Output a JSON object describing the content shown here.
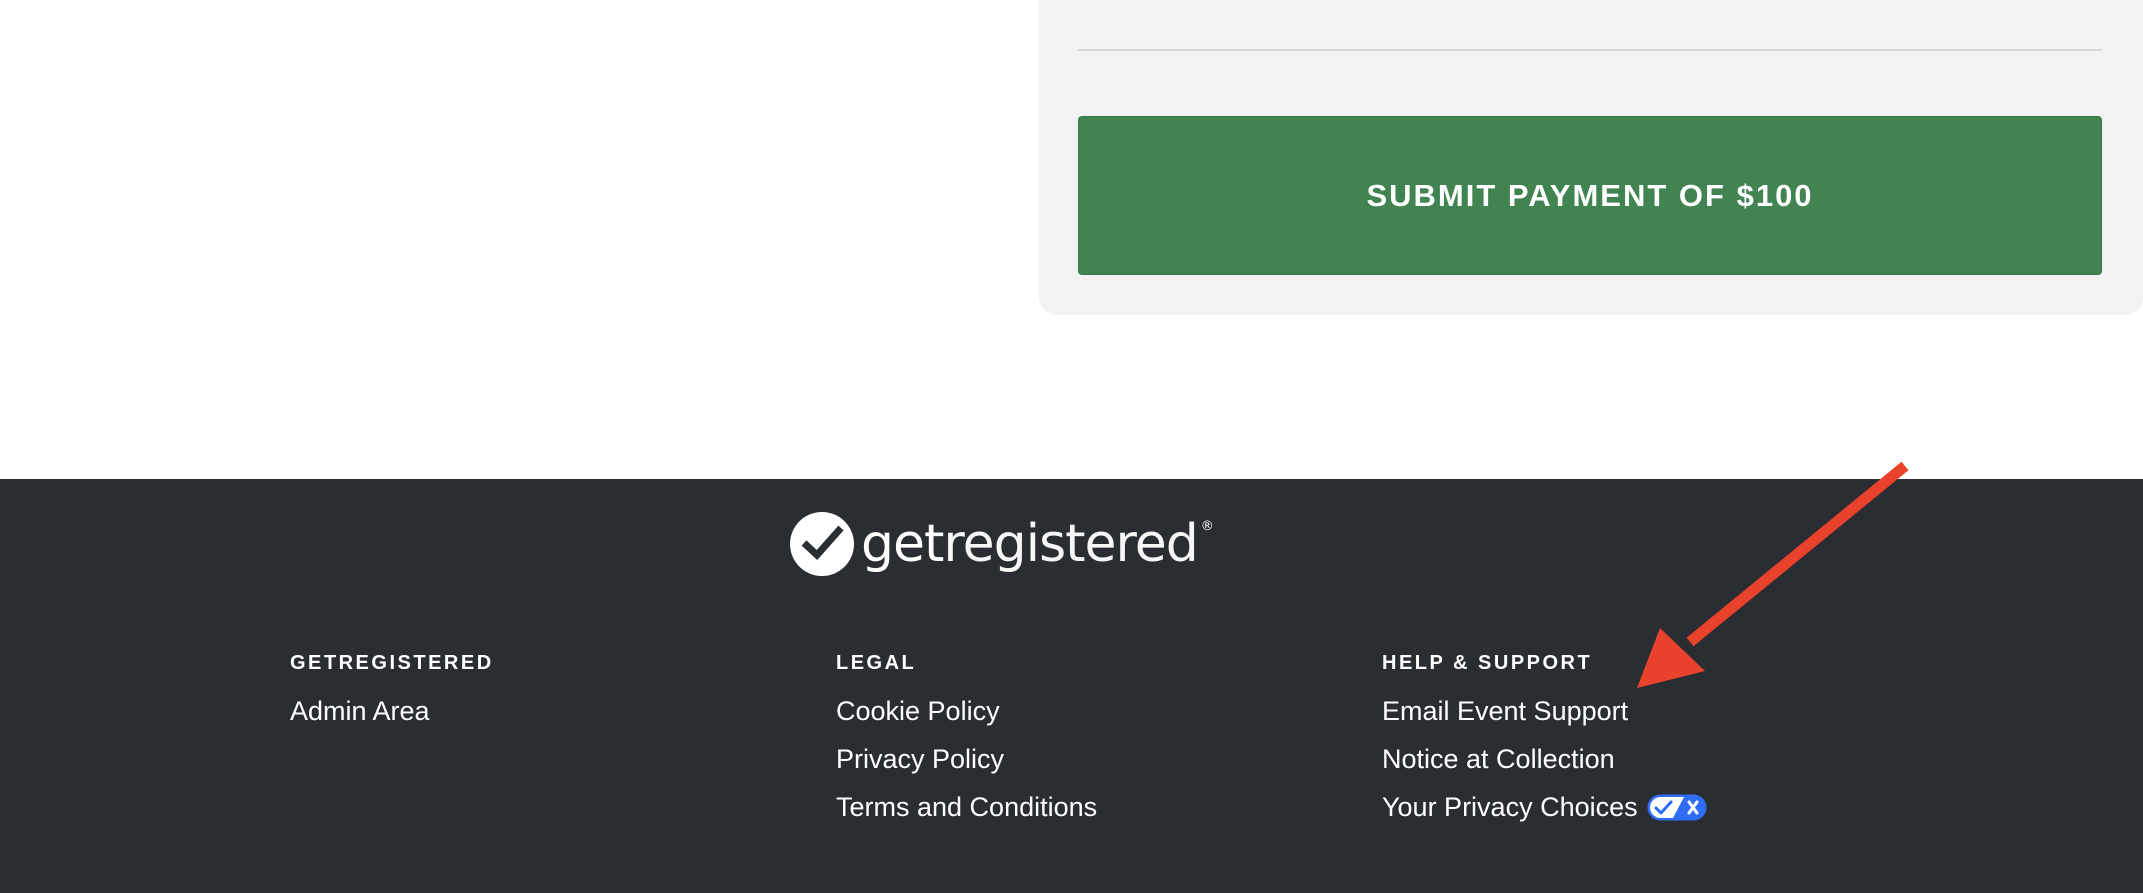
{
  "payment": {
    "submit_label": "SUBMIT PAYMENT OF $100"
  },
  "footer": {
    "logo": {
      "text_bold": "get",
      "text_light": "registered",
      "registered_mark": "®"
    },
    "columns": [
      {
        "heading": "GETREGISTERED",
        "links": [
          "Admin Area"
        ]
      },
      {
        "heading": "LEGAL",
        "links": [
          "Cookie Policy",
          "Privacy Policy",
          "Terms and Conditions"
        ]
      },
      {
        "heading": "HELP & SUPPORT",
        "links": [
          "Email Event Support",
          "Notice at Collection",
          "Your Privacy Choices"
        ]
      }
    ]
  },
  "icons": {
    "logo": "checkmark-circle-icon",
    "privacy_choices": "privacy-choices-toggle-icon",
    "annotation": "red-arrow-icon"
  },
  "colors": {
    "submit_button": "#418452",
    "footer_background": "#2a2d32",
    "panel_background": "#f2f2f2",
    "privacy_toggle": "#2f6df6",
    "annotation_arrow": "#e8412c"
  }
}
